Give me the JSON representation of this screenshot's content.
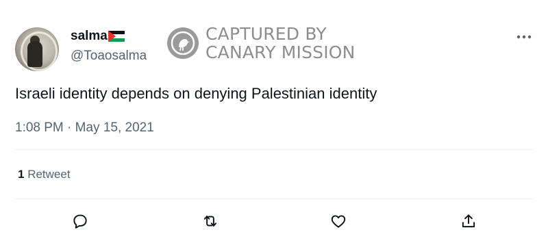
{
  "tweet": {
    "author": {
      "display_name": "salma",
      "handle": "@Toaosalma",
      "flag_icon": "palestine-flag-icon"
    },
    "text": "Israeli identity depends on denying Palestinian identity",
    "timestamp": "1:08 PM · May 15, 2021",
    "retweet_count": "1",
    "retweet_label": "Retweet"
  },
  "watermark": {
    "line1": "CAPTURED BY",
    "line2": "CANARY MISSION",
    "icon": "canary-bird-icon"
  },
  "actions": [
    {
      "name": "reply",
      "icon": "reply-bubble-icon"
    },
    {
      "name": "retweet",
      "icon": "retweet-arrows-icon"
    },
    {
      "name": "like",
      "icon": "heart-icon"
    },
    {
      "name": "share",
      "icon": "share-upload-icon"
    }
  ],
  "colors": {
    "text": "#0f1419",
    "secondary": "#536471",
    "divider": "#eff3f4",
    "watermark": "#8d8d8d"
  }
}
